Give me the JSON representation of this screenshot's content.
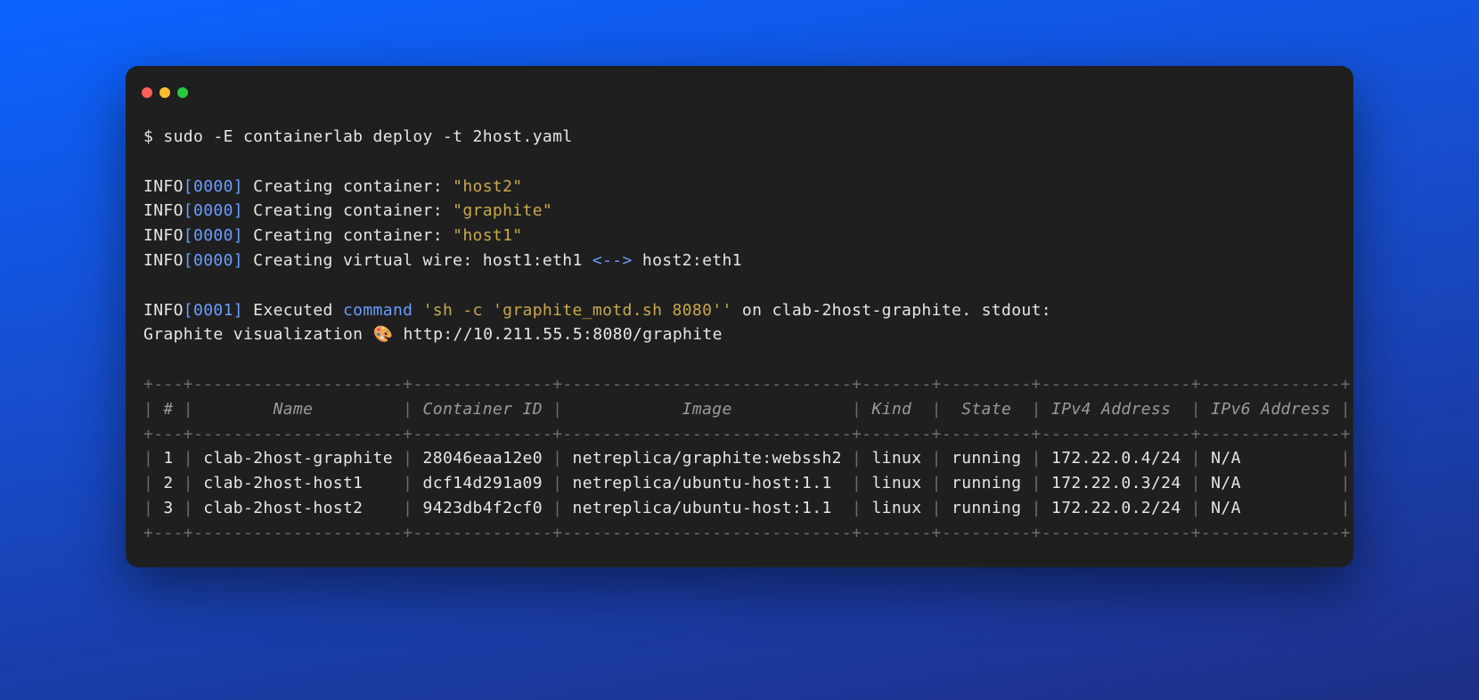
{
  "window": {
    "close_color": "#ff5f56",
    "min_color": "#ffbd2e",
    "max_color": "#27c93f"
  },
  "prompt": {
    "symbol": "$",
    "command": "sudo -E containerlab deploy -t 2host.yaml"
  },
  "log_lines": [
    {
      "tag": "INFO",
      "ts": "0000",
      "text_pre": "Creating container: ",
      "quoted": "host2",
      "text_post": ""
    },
    {
      "tag": "INFO",
      "ts": "0000",
      "text_pre": "Creating container: ",
      "quoted": "graphite",
      "text_post": ""
    },
    {
      "tag": "INFO",
      "ts": "0000",
      "text_pre": "Creating container: ",
      "quoted": "host1",
      "text_post": ""
    }
  ],
  "wire_line": {
    "tag": "INFO",
    "ts": "0000",
    "text_pre": "Creating virtual wire: host1:eth1 ",
    "arrow": "<-->",
    "text_post": " host2:eth1"
  },
  "exec_line": {
    "tag": "INFO",
    "ts": "0001",
    "pre": "Executed ",
    "kw": "command",
    "space": " ",
    "q1": "'sh -c '",
    "q2": "graphite_motd.sh 8080",
    "q3": "''",
    "post": " on clab-2host-graphite. stdout:"
  },
  "vis_line": {
    "text_pre": "Graphite visualization ",
    "emoji": "🎨",
    "url": " http://10.211.55.5:8080/graphite"
  },
  "table": {
    "border": "+---+---------------------+--------------+-----------------------------+-------+---------+---------------+--------------+",
    "header": [
      "#",
      "Name",
      "Container ID",
      "Image",
      "Kind",
      "State",
      "IPv4 Address",
      "IPv6 Address"
    ],
    "rows": [
      {
        "num": "1",
        "name": "clab-2host-graphite",
        "cid": "28046eaa12e0",
        "image": "netreplica/graphite:webssh2",
        "kind": "linux",
        "state": "running",
        "ipv4": "172.22.0.4/24",
        "ipv6": "N/A"
      },
      {
        "num": "2",
        "name": "clab-2host-host1",
        "cid": "dcf14d291a09",
        "image": "netreplica/ubuntu-host:1.1",
        "kind": "linux",
        "state": "running",
        "ipv4": "172.22.0.3/24",
        "ipv6": "N/A"
      },
      {
        "num": "3",
        "name": "clab-2host-host2",
        "cid": "9423db4f2cf0",
        "image": "netreplica/ubuntu-host:1.1",
        "kind": "linux",
        "state": "running",
        "ipv4": "172.22.0.2/24",
        "ipv6": "N/A"
      }
    ],
    "col_widths": {
      "num": 1,
      "name": 19,
      "cid": 12,
      "image": 27,
      "kind": 5,
      "state": 7,
      "ipv4": 13,
      "ipv6": 12
    }
  }
}
